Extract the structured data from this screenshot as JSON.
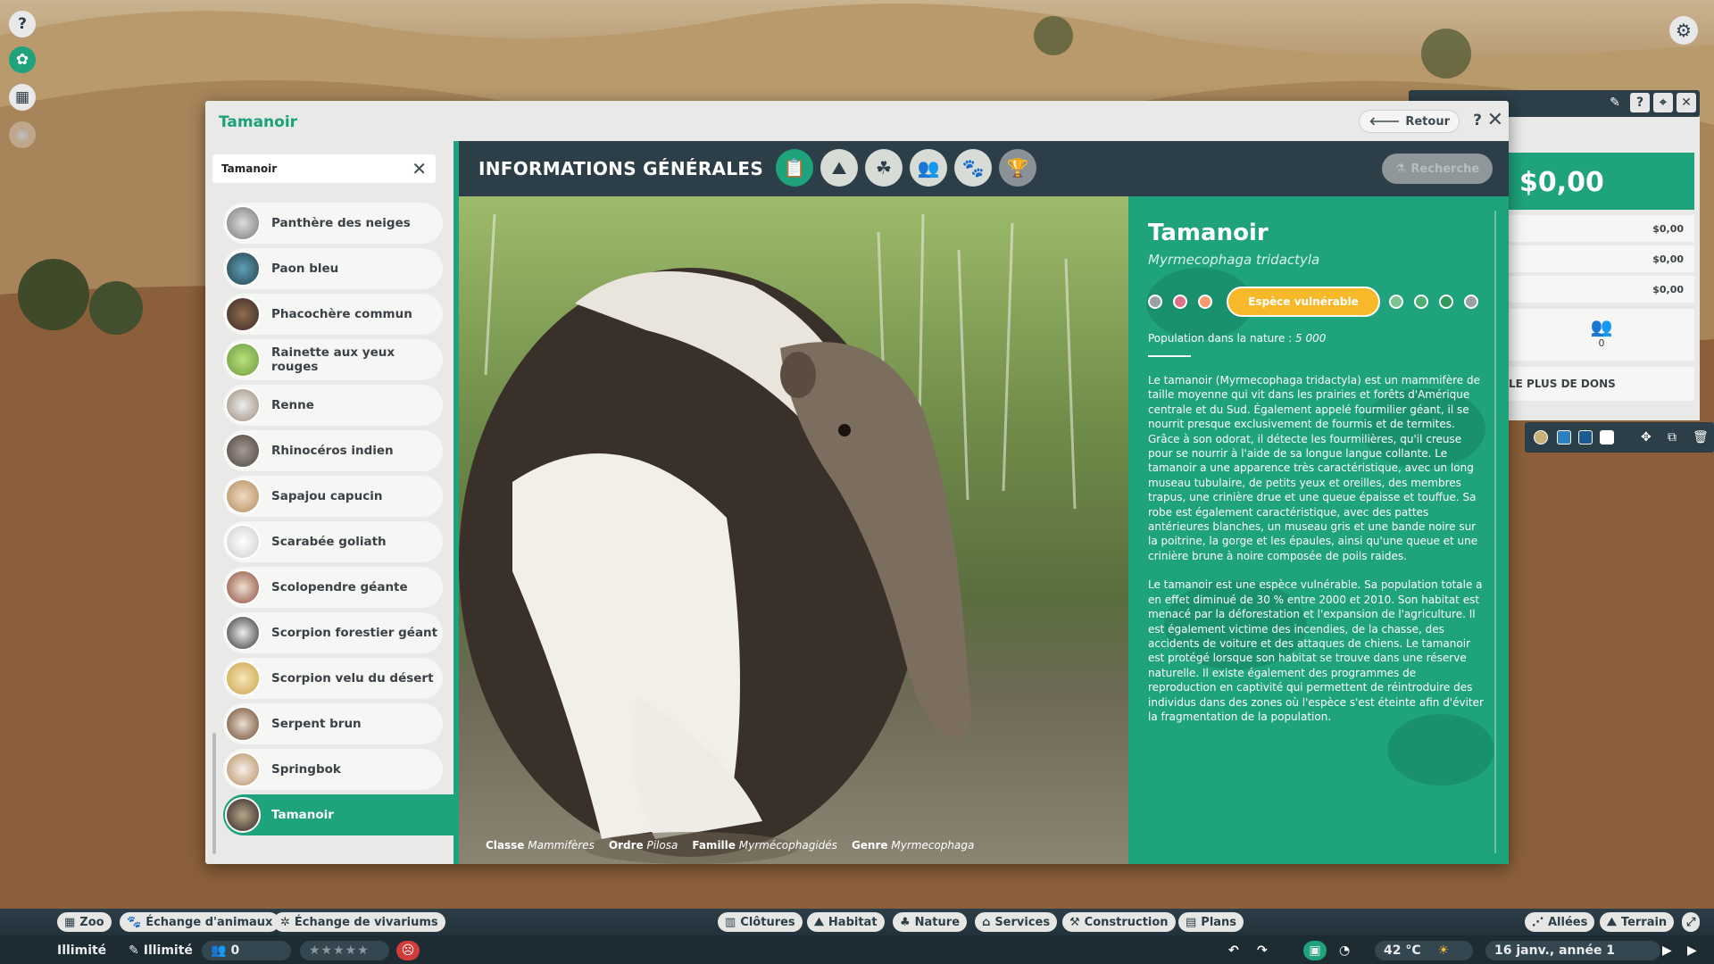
{
  "colors": {
    "accent": "#1ea37c",
    "panel": "#2c3e48",
    "badge": "#f7b82a"
  },
  "left_toolbar": [
    {
      "icon": "help-icon",
      "glyph": "?"
    },
    {
      "icon": "zoo-info-icon",
      "glyph": "✿"
    },
    {
      "icon": "calendar-icon",
      "glyph": "▦"
    },
    {
      "icon": "eye-icon",
      "glyph": "◉"
    }
  ],
  "window": {
    "title": "Tamanoir",
    "back_label": "Retour",
    "help_glyph": "?",
    "close_glyph": "✕"
  },
  "search": {
    "value": "Tamanoir",
    "clear_glyph": "✕"
  },
  "animal_list": [
    {
      "name": "Panthère des neiges"
    },
    {
      "name": "Paon bleu"
    },
    {
      "name": "Phacochère commun"
    },
    {
      "name": "Rainette aux yeux rouges"
    },
    {
      "name": "Renne"
    },
    {
      "name": "Rhinocéros indien"
    },
    {
      "name": "Sapajou capucin"
    },
    {
      "name": "Scarabée goliath"
    },
    {
      "name": "Scolopendre géante"
    },
    {
      "name": "Scorpion forestier géant"
    },
    {
      "name": "Scorpion velu du désert"
    },
    {
      "name": "Serpent brun"
    },
    {
      "name": "Springbok"
    },
    {
      "name": "Tamanoir",
      "selected": true
    }
  ],
  "header": {
    "title": "INFORMATIONS GÉNÉRALES",
    "tabs": [
      {
        "icon": "clipboard-icon",
        "glyph": "📋",
        "active": true
      },
      {
        "icon": "habitat-icon",
        "glyph": "⛰"
      },
      {
        "icon": "food-icon",
        "glyph": "☘"
      },
      {
        "icon": "social-icon",
        "glyph": "👥"
      },
      {
        "icon": "paw-icon",
        "glyph": "🐾"
      },
      {
        "icon": "trophy-icon",
        "glyph": "🏆",
        "dim": true
      }
    ],
    "research_label": "Recherche"
  },
  "photo": {
    "taxonomy": [
      {
        "label": "Classe",
        "value": "Mammifères"
      },
      {
        "label": "Ordre",
        "value": "Pilosa"
      },
      {
        "label": "Famille",
        "value": "Myrmécophagidés"
      },
      {
        "label": "Genre",
        "value": "Myrmecophaga"
      }
    ]
  },
  "species": {
    "name": "Tamanoir",
    "scientific": "Myrmecophaga tridactyla",
    "status": "Espèce vulnérable",
    "status_dots": [
      "#9aa1a4",
      "#e06f8a",
      "#f59a6b",
      "#7cc48e",
      "#4fae6f",
      "#2f9a5c",
      "#9aa1a4"
    ],
    "population_label": "Population dans la nature :",
    "population_value": "5 000",
    "description_1": "Le tamanoir (Myrmecophaga tridactyla) est un mammifère de taille moyenne qui vit dans les prairies et forêts d'Amérique centrale et du Sud. Également appelé fourmilier géant, il se nourrit presque exclusivement de fourmis et de termites. Grâce à son odorat, il détecte les fourmilières, qu'il creuse pour se nourrir à l'aide de sa longue langue collante. Le tamanoir a une apparence très caractéristique, avec un long museau tubulaire, de petits yeux et oreilles, des membres trapus, une crinière drue et une queue épaisse et touffue. Sa robe est également caractéristique, avec des pattes antérieures blanches, un museau gris et une bande noire sur la poitrine, la gorge et les épaules, ainsi qu'une queue et une crinière brune à noire composée de poils raides.",
    "description_2": "Le tamanoir est une espèce vulnérable. Sa population totale a en effet diminué de 30 % entre 2000 et 2010. Son habitat est menacé par la déforestation et l'expansion de l'agriculture. Il est également victime des incendies, de la chasse, des accidents de voiture et des attaques de chiens. Le tamanoir est protégé lorsque son habitat se trouve dans une réserve naturelle. Il existe également des programmes de reproduction en captivité qui permettent de réintroduire des individus dans des zones où l'espèce s'est éteinte afin d'éviter la fragmentation de la population."
  },
  "finance": {
    "balance": "$0,00",
    "rows": [
      "$0,00",
      "$0,00",
      "$0,00"
    ],
    "visitors": "0",
    "donations_label": "LE PLUS DE DONS"
  },
  "bottom_bar": {
    "left": [
      {
        "icon": "zoo-icon",
        "label": "Zoo"
      },
      {
        "icon": "paw-icon",
        "label": "Échange d'animaux"
      },
      {
        "icon": "bug-icon",
        "label": "Échange de vivariums"
      }
    ],
    "center": [
      {
        "icon": "fence-icon",
        "label": "Clôtures"
      },
      {
        "icon": "habitat-icon",
        "label": "Habitat"
      },
      {
        "icon": "tree-icon",
        "label": "Nature"
      },
      {
        "icon": "shop-icon",
        "label": "Services"
      },
      {
        "icon": "build-icon",
        "label": "Construction"
      },
      {
        "icon": "blueprint-icon",
        "label": "Plans"
      }
    ],
    "right": [
      {
        "icon": "path-icon",
        "label": "Allées"
      },
      {
        "icon": "terrain-icon",
        "label": "Terrain"
      }
    ],
    "status": {
      "money": "Illimité",
      "research": "Illimité",
      "guests": "0",
      "temperature": "42 °C",
      "date": "16 janv., année 1"
    }
  }
}
